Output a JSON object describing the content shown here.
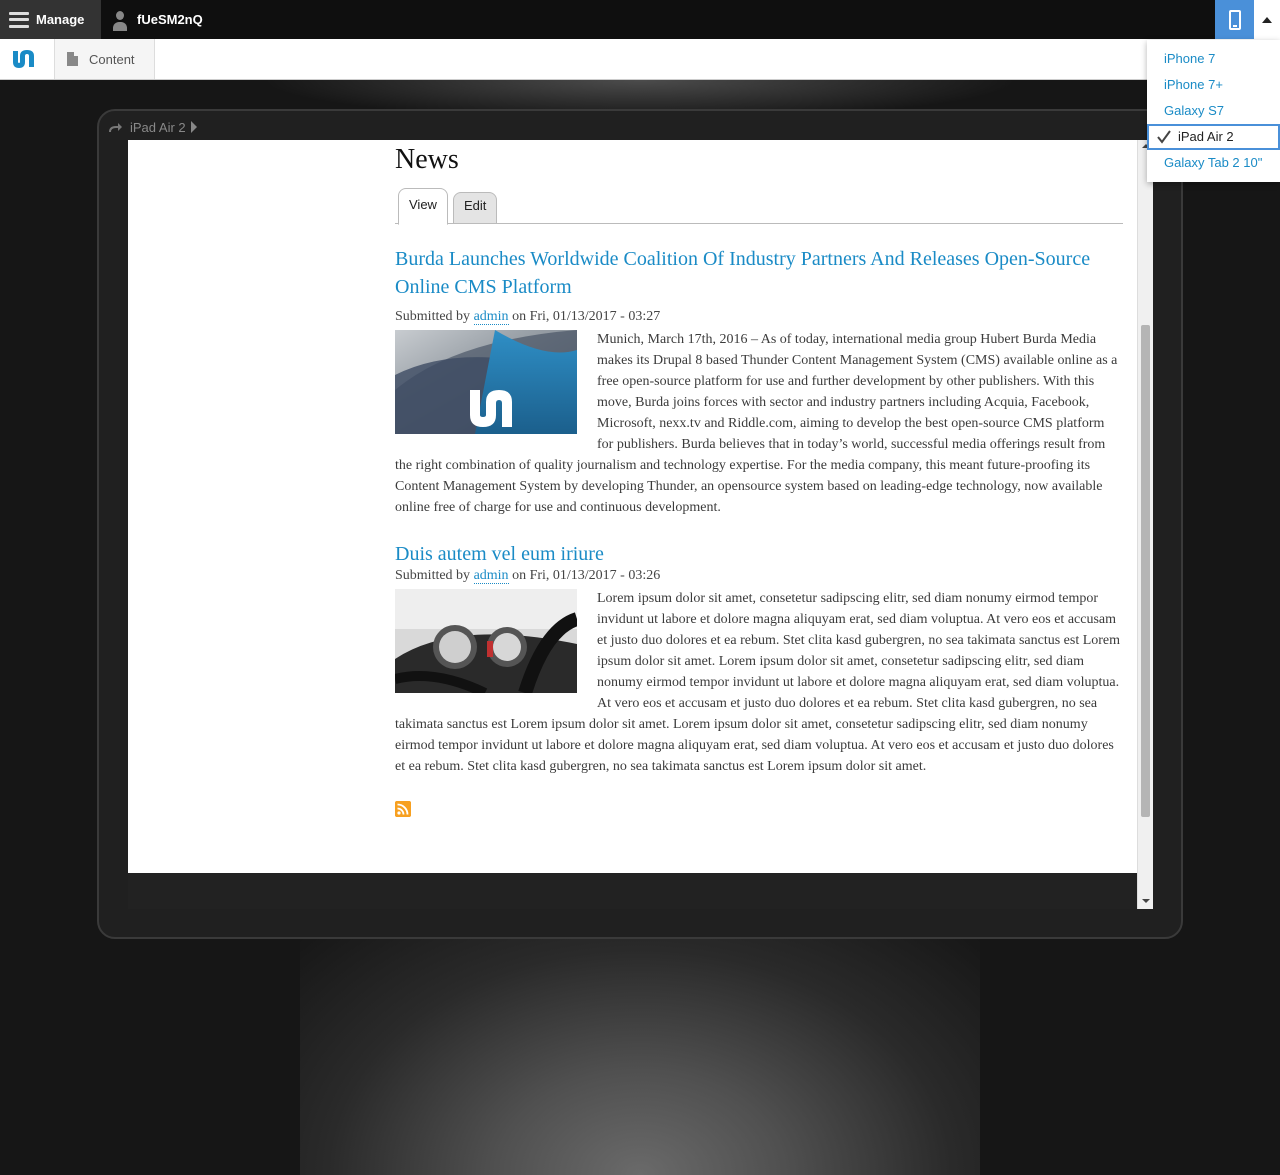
{
  "toolbar": {
    "manage_label": "Manage",
    "user_label": "fUeSM2nQ"
  },
  "tray": {
    "content_label": "Content"
  },
  "device_menu": {
    "items": [
      "iPhone 7",
      "iPhone 7+",
      "Galaxy S7",
      "iPad Air 2",
      "Galaxy Tab 2 10\""
    ],
    "selected": "iPad Air 2"
  },
  "frame": {
    "device_label": "iPad Air 2"
  },
  "page": {
    "title": "News",
    "tabs": [
      "View",
      "Edit"
    ]
  },
  "articles": [
    {
      "title": "Burda Launches Worldwide Coalition Of Industry Partners And Releases Open-Source Online CMS Platform",
      "submitted_prefix": "Submitted by",
      "author": "admin",
      "date": "on Fri, 01/13/2017 - 03:27",
      "body": "Munich, March 17th, 2016 – As of today, international media group Hubert Burda Media makes its Drupal 8 based Thunder Content Management System (CMS) available online as a free open-source platform for use and further development by other publishers. With this move, Burda joins forces with sector and industry partners including Acquia, Facebook, Microsoft, nexx.tv and Riddle.com, aiming to develop the best open-source CMS platform for publishers. Burda believes that in today’s world, successful media offerings result from the right combination of quality journalism and technology expertise. For the media company, this meant future-proofing its Content Management System by developing Thunder, an opensource system based on leading-edge technology, now available online free of charge for use and continuous development."
    },
    {
      "title": "Duis autem vel eum iriure",
      "submitted_prefix": "Submitted by",
      "author": "admin",
      "date": "on Fri, 01/13/2017 - 03:26",
      "body": "Lorem ipsum dolor sit amet, consetetur sadipscing elitr, sed diam nonumy eirmod tempor invidunt ut labore et dolore magna aliquyam erat, sed diam voluptua. At vero eos et accusam et justo duo dolores et ea rebum. Stet clita kasd gubergren, no sea takimata sanctus est Lorem ipsum dolor sit amet. Lorem ipsum dolor sit amet, consetetur sadipscing elitr, sed diam nonumy eirmod tempor invidunt ut labore et dolore magna aliquyam erat, sed diam voluptua. At vero eos et accusam et justo duo dolores et ea rebum. Stet clita kasd gubergren, no sea takimata sanctus est Lorem ipsum dolor sit amet. Lorem ipsum dolor sit amet, consetetur sadipscing elitr, sed diam nonumy eirmod tempor invidunt ut labore et dolore magna aliquyam erat, sed diam voluptua. At vero eos et accusam et justo duo dolores et ea rebum. Stet clita kasd gubergren, no sea takimata sanctus est Lorem ipsum dolor sit amet."
    }
  ],
  "icons": {
    "menu": "hamburger-icon",
    "user": "user-icon",
    "device": "phone-icon",
    "logo": "thunder-logo-icon",
    "content": "document-icon",
    "rotate": "rotate-icon",
    "feed": "rss-icon"
  },
  "colors": {
    "accent": "#4a90d9",
    "link": "#1a8bc6",
    "toolbar_bg": "#0f0f0f"
  }
}
